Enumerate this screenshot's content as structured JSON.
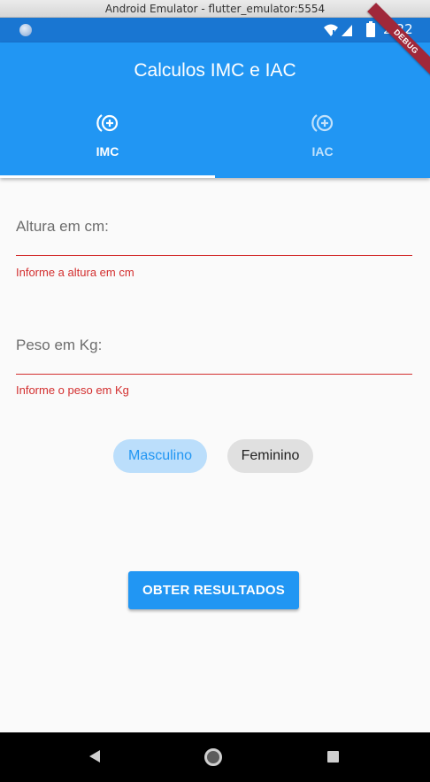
{
  "window": {
    "title": "Android Emulator - flutter_emulator:5554"
  },
  "status_bar": {
    "time": "2:22"
  },
  "debug_banner": "DEBUG",
  "app_bar": {
    "title": "Calculos IMC e IAC"
  },
  "tabs": [
    {
      "label": "IMC",
      "icon": "add-circle-outline-icon",
      "selected": true
    },
    {
      "label": "IAC",
      "icon": "add-circle-outline-icon",
      "selected": false
    }
  ],
  "form": {
    "altura": {
      "label": "Altura em cm:",
      "value": "",
      "error": "Informe a altura em cm"
    },
    "peso": {
      "label": "Peso em Kg:",
      "value": "",
      "error": "Informe o peso em Kg"
    }
  },
  "gender": {
    "options": [
      "Masculino",
      "Feminino"
    ],
    "selected": "Masculino"
  },
  "submit": {
    "label": "OBTER RESULTADOS"
  },
  "colors": {
    "primary": "#2196f3",
    "status_bar": "#1976d2",
    "error": "#d32f2f",
    "chip_selected_bg": "#bbdefb",
    "chip_bg": "#e0e0e0",
    "debug_banner": "#a0283a"
  }
}
